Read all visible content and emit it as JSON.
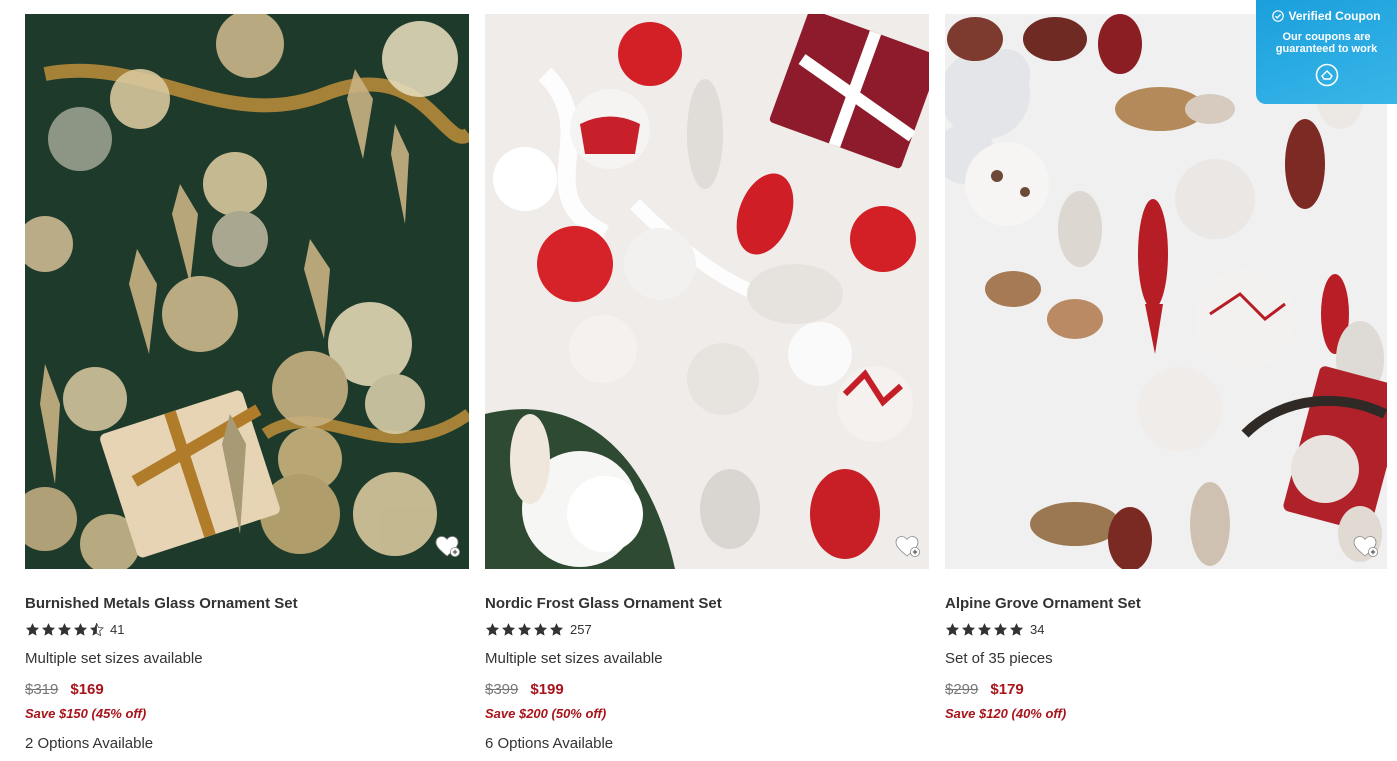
{
  "products": [
    {
      "title": "Burnished Metals Glass Ornament Set",
      "rating": 4.5,
      "review_count": "41",
      "description": "Multiple set sizes available",
      "original_price": "$319",
      "sale_price": "$169",
      "savings": "Save $150 (45% off)",
      "options": "2 Options Available",
      "image_bg": "#1f3a2c"
    },
    {
      "title": "Nordic Frost Glass Ornament Set",
      "rating": 5,
      "review_count": "257",
      "description": "Multiple set sizes available",
      "original_price": "$399",
      "sale_price": "$199",
      "savings": "Save $200 (50% off)",
      "options": "6 Options Available",
      "image_bg": "#efecea"
    },
    {
      "title": "Alpine Grove Ornament Set",
      "rating": 5,
      "review_count": "34",
      "description": "Set of 35 pieces",
      "original_price": "$299",
      "sale_price": "$179",
      "savings": "Save $120 (40% off)",
      "options": "",
      "image_bg": "#f2f2f2"
    }
  ],
  "coupon": {
    "title": "Verified Coupon",
    "line1": "Our coupons are",
    "line2": "guaranteed to work"
  },
  "colors": {
    "sale": "#a8141b",
    "coupon_bg": "#1b9fdc"
  },
  "icons": {
    "wishlist": "heart-plus-icon",
    "star": "star-icon",
    "coupon": "check-circle-icon"
  }
}
